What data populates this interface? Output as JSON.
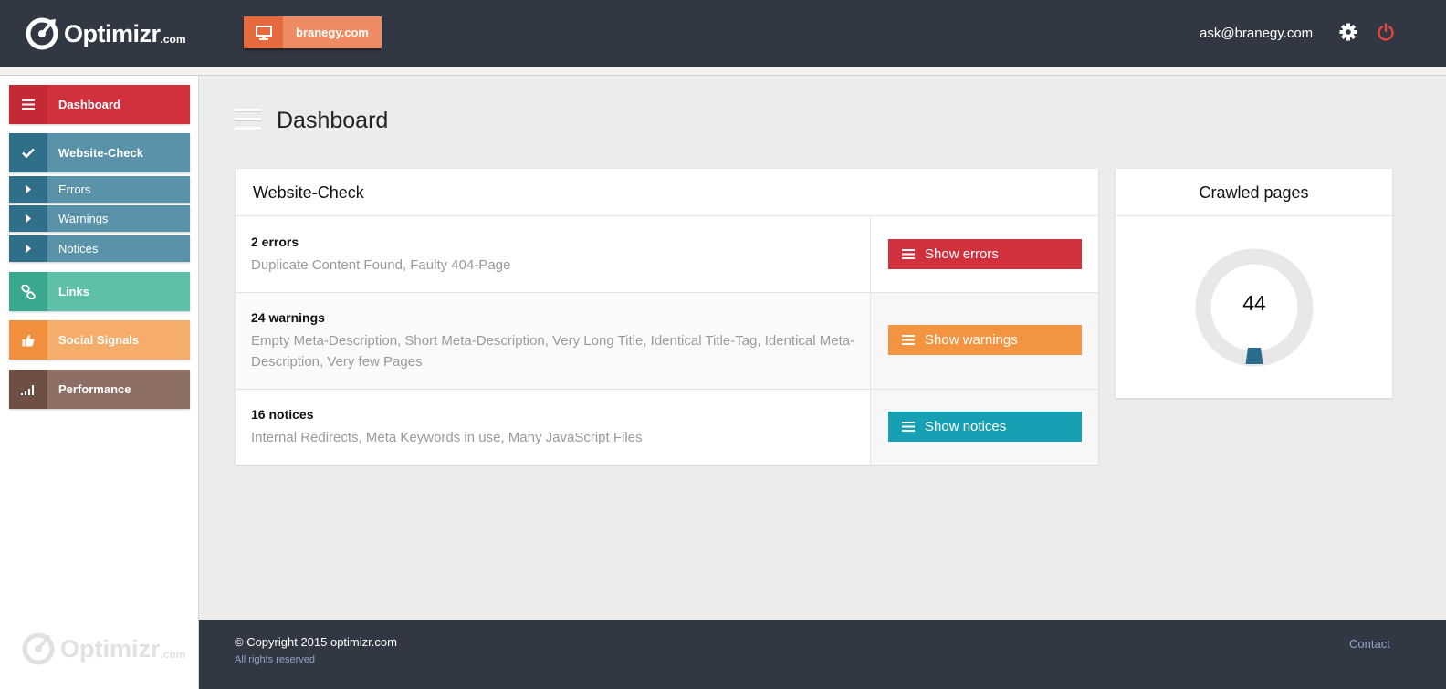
{
  "header": {
    "logo_text": "Optimizr",
    "logo_suffix": ".com",
    "site_button_label": "branegy.com",
    "user_email": "ask@branegy.com",
    "settings_icon": "gear-icon",
    "logout_icon": "power-icon"
  },
  "sidebar": {
    "items": [
      {
        "label": "Dashboard",
        "icon": "menu-icon",
        "color": "#d0313d"
      },
      {
        "label": "Website-Check",
        "icon": "check-icon",
        "color": "#5a92aa"
      },
      {
        "label": "Errors",
        "icon": "caret-right-icon",
        "color": "#5a92aa"
      },
      {
        "label": "Warnings",
        "icon": "caret-right-icon",
        "color": "#5a92aa"
      },
      {
        "label": "Notices",
        "icon": "caret-right-icon",
        "color": "#5a92aa"
      },
      {
        "label": "Links",
        "icon": "link-icon",
        "color": "#5fc0aa"
      },
      {
        "label": "Social Signals",
        "icon": "thumbs-up-icon",
        "color": "#f6ad6b"
      },
      {
        "label": "Performance",
        "icon": "signal-bars-icon",
        "color": "#8d6f66"
      }
    ],
    "footer_logo_text": "Optimizr",
    "footer_logo_suffix": ".com"
  },
  "main": {
    "page_title": "Dashboard",
    "website_check": {
      "title": "Website-Check",
      "rows": [
        {
          "count_label": "2 errors",
          "details": "Duplicate Content Found, Faulty 404-Page",
          "button": "Show errors",
          "color": "#d0313d"
        },
        {
          "count_label": "24 warnings",
          "details": "Empty Meta-Description, Short Meta-Description, Very Long Title, Identical Title-Tag, Identical Meta-Description, Very few Pages",
          "button": "Show warnings",
          "color": "#f39441"
        },
        {
          "count_label": "16 notices",
          "details": "Internal Redirects, Meta Keywords in use, Many JavaScript Files",
          "button": "Show notices",
          "color": "#17a0b4"
        }
      ]
    },
    "crawled_pages": {
      "title": "Crawled pages",
      "value": "44",
      "gauge_color": "#2b6d8c",
      "track_color": "#e8e8e8"
    }
  },
  "footer": {
    "copyright": "© Copyright 2015 optimizr.com",
    "rights": "All rights reserved",
    "contact": "Contact"
  }
}
